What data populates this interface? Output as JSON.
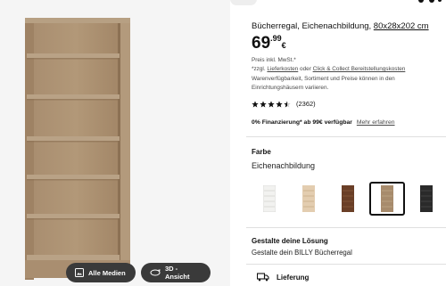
{
  "product": {
    "title": "Bücherregal, Eichenachbildung,",
    "size_link": "80x28x202 cm",
    "price_integer": "69",
    "price_decimal": ".99",
    "price_currency": "€",
    "vat_note": "Preis inkl. MwSt.*",
    "notes_prefix": "*zzgl.",
    "notes_link1": "Lieferkosten",
    "notes_mid": "oder",
    "notes_link2": "Click & Collect Bereitstellungskosten",
    "notes_rest": "Warenverfügbarkeit, Sortiment und Preise können in den Einrichtungshäusern variieren.",
    "rating_value": 4.5,
    "rating_count": "(2362)",
    "finance_text": "0% Finanzierung* ab 99€ verfügbar",
    "finance_link": "Mehr erfahren"
  },
  "color_section": {
    "heading": "Farbe",
    "value": "Eichenachbildung",
    "swatches": [
      {
        "name": "white",
        "color": "#f2f2f0",
        "selected": false
      },
      {
        "name": "birch",
        "color": "#e3cdb0",
        "selected": false
      },
      {
        "name": "brown-walnut",
        "color": "#6a3f27",
        "selected": false
      },
      {
        "name": "oak-effect",
        "color": "#a78b6c",
        "selected": true
      },
      {
        "name": "black-brown",
        "color": "#2a2a2a",
        "selected": false
      }
    ]
  },
  "solution_section": {
    "heading": "Gestalte deine Lösung",
    "text": "Gestalte dein BILLY Bücherregal"
  },
  "delivery": {
    "label": "Lieferung"
  },
  "media": {
    "all_media_label": "Alle Medien",
    "view_3d_label": "3D -Ansicht"
  },
  "colors": {
    "shelf_wood": "#a58a6b",
    "shelf_dark": "#8c7154",
    "button_bg": "#3a3a3a",
    "star": "#111111"
  }
}
